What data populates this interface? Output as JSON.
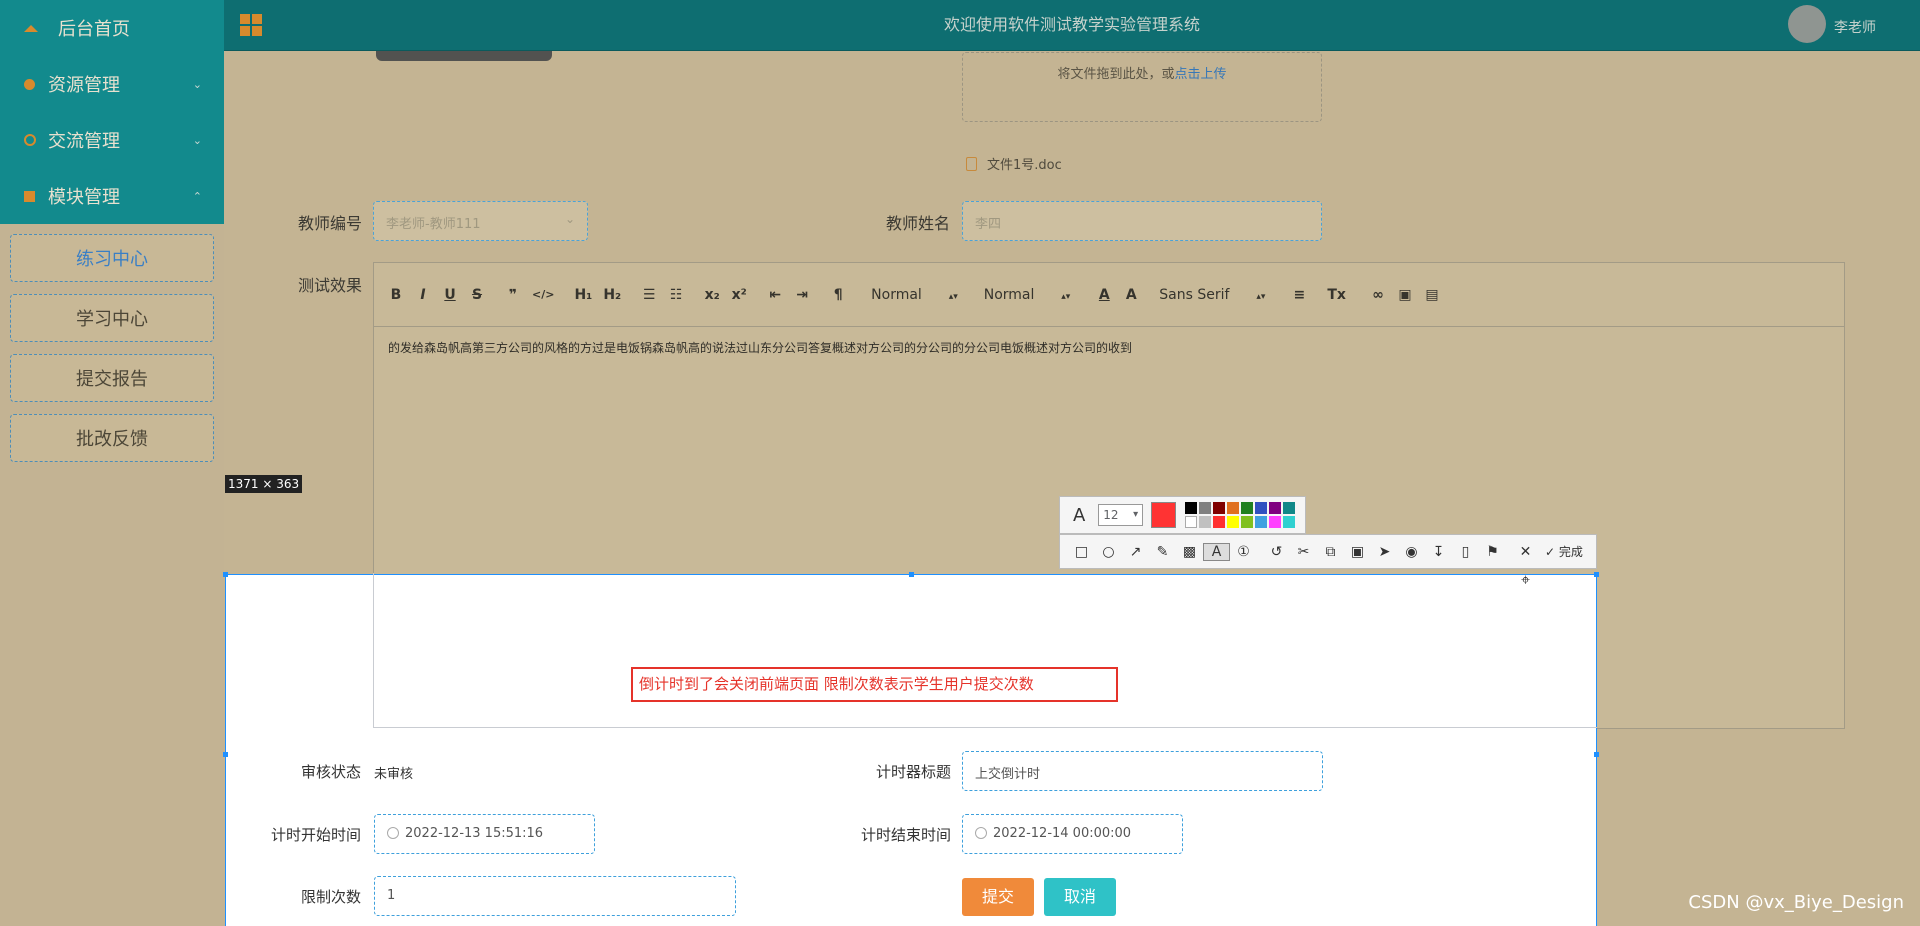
{
  "sidebar": {
    "menu": [
      {
        "label": "后台首页",
        "icon": "home-icon"
      },
      {
        "label": "资源管理",
        "icon": "resource-icon"
      },
      {
        "label": "交流管理",
        "icon": "chat-icon"
      },
      {
        "label": "模块管理",
        "icon": "module-icon"
      }
    ],
    "submenu": [
      "练习中心",
      "学习中心",
      "提交报告",
      "批改反馈"
    ]
  },
  "header": {
    "title": "欢迎使用软件测试教学实验管理系统",
    "user": "李老师"
  },
  "form": {
    "upload_tip": "将文件拖到此处，或",
    "upload_link": "点击上传",
    "file_name": "文件1号.doc",
    "teacher_id_label": "教师编号",
    "teacher_id_value": "李老师-教师111",
    "teacher_name_label": "教师姓名",
    "teacher_name_value": "李四",
    "test_effect_label": "测试效果",
    "editor_toolbar": {
      "bold": "B",
      "italic": "I",
      "underline": "U",
      "strike": "S",
      "quote": "❞",
      "code": "</>",
      "h1": "H₁",
      "h2": "H₂",
      "ol": "☰",
      "ul": "☷",
      "sub": "x₂",
      "sup": "x²",
      "outdent": "⇤",
      "indent": "⇥",
      "direction": "¶",
      "size": "Normal",
      "header": "Normal",
      "font": "Sans Serif",
      "align": "≡",
      "clean": "Tx",
      "link": "🔗",
      "image": "▣",
      "video": "▤"
    },
    "editor_content": "的发给森岛帆高第三方公司的风格的方过是电饭锅森岛帆高的说法过山东分公司答复概述对方公司的分公司的分公司电饭概述对方公司的收到",
    "review_status_label": "审核状态",
    "review_status_value": "未审核",
    "timer_title_label": "计时器标题",
    "timer_title_value": "上交倒计时",
    "start_time_label": "计时开始时间",
    "start_time_value": "2022-12-13 15:51:16",
    "end_time_label": "计时结束时间",
    "end_time_value": "2022-12-14 00:00:00",
    "limit_label": "限制次数",
    "limit_value": "1",
    "submit": "提交",
    "cancel": "取消"
  },
  "capture": {
    "dimensions": "1371 × 363",
    "annotation_text": "倒计时到了会关闭前端页面  限制次数表示学生用户提交次数",
    "font_size": "12",
    "done_label": "完成",
    "colors": [
      "#000000",
      "#808080",
      "#800000",
      "#e07020",
      "#208020",
      "#3050c0",
      "#800080",
      "#108888",
      "#ffffff",
      "#c0c0c0",
      "#ff3030",
      "#ffff00",
      "#80c020",
      "#40a0e0",
      "#ff40ff",
      "#30d0d0"
    ]
  },
  "watermark": "CSDN @vx_Biye_Design"
}
